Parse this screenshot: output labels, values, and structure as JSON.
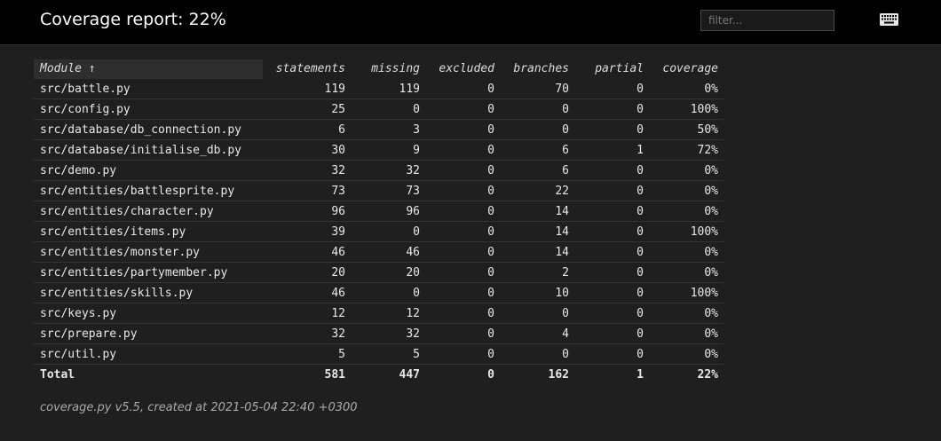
{
  "header": {
    "title": "Coverage report: 22%",
    "filter_placeholder": "filter...",
    "keyboard_icon": "keyboard-icon"
  },
  "table": {
    "columns": [
      "Module ↑",
      "statements",
      "missing",
      "excluded",
      "branches",
      "partial",
      "coverage"
    ],
    "rows": [
      [
        "src/battle.py",
        "119",
        "119",
        "0",
        "70",
        "0",
        "0%"
      ],
      [
        "src/config.py",
        "25",
        "0",
        "0",
        "0",
        "0",
        "100%"
      ],
      [
        "src/database/db_connection.py",
        "6",
        "3",
        "0",
        "0",
        "0",
        "50%"
      ],
      [
        "src/database/initialise_db.py",
        "30",
        "9",
        "0",
        "6",
        "1",
        "72%"
      ],
      [
        "src/demo.py",
        "32",
        "32",
        "0",
        "6",
        "0",
        "0%"
      ],
      [
        "src/entities/battlesprite.py",
        "73",
        "73",
        "0",
        "22",
        "0",
        "0%"
      ],
      [
        "src/entities/character.py",
        "96",
        "96",
        "0",
        "14",
        "0",
        "0%"
      ],
      [
        "src/entities/items.py",
        "39",
        "0",
        "0",
        "14",
        "0",
        "100%"
      ],
      [
        "src/entities/monster.py",
        "46",
        "46",
        "0",
        "14",
        "0",
        "0%"
      ],
      [
        "src/entities/partymember.py",
        "20",
        "20",
        "0",
        "2",
        "0",
        "0%"
      ],
      [
        "src/entities/skills.py",
        "46",
        "0",
        "0",
        "10",
        "0",
        "100%"
      ],
      [
        "src/keys.py",
        "12",
        "12",
        "0",
        "0",
        "0",
        "0%"
      ],
      [
        "src/prepare.py",
        "32",
        "32",
        "0",
        "4",
        "0",
        "0%"
      ],
      [
        "src/util.py",
        "5",
        "5",
        "0",
        "0",
        "0",
        "0%"
      ]
    ],
    "total": [
      "Total",
      "581",
      "447",
      "0",
      "162",
      "1",
      "22%"
    ]
  },
  "footer": {
    "text": "coverage.py v5.5, created at 2021-05-04 22:40 +0300"
  },
  "colors": {
    "background": "#1f1f1f",
    "header_background": "#000000",
    "text": "#eeeeee",
    "row_border": "#333333"
  }
}
